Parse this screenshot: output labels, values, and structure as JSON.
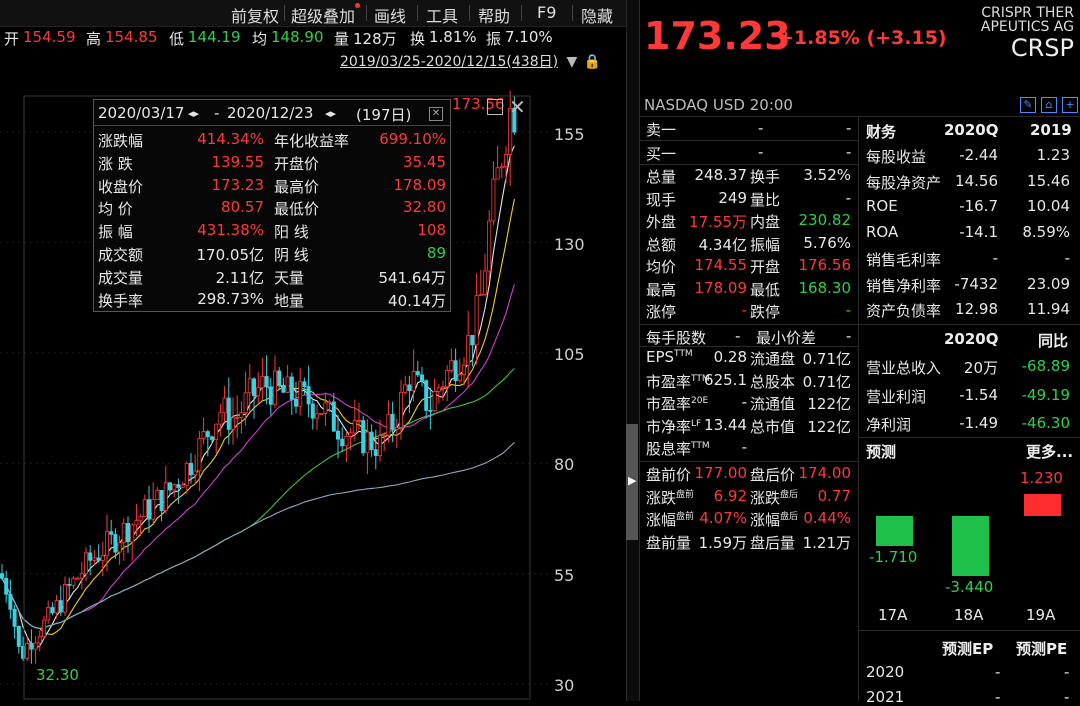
{
  "toolbar": {
    "items": [
      "前复权",
      "超级叠加",
      "画线",
      "工具",
      "帮助",
      "F9",
      "隐藏"
    ]
  },
  "quote": {
    "open_label": "开",
    "open": "154.59",
    "high_label": "高",
    "high": "154.85",
    "low_label": "低",
    "low": "144.19",
    "avg_label": "均",
    "avg": "148.90",
    "vol_label": "量",
    "vol": "128万",
    "turn_label": "换",
    "turn": "1.81%",
    "amp_label": "振",
    "amp": "7.10%"
  },
  "range": {
    "text": "2019/03/25-2020/12/15(438日)"
  },
  "chart": {
    "y_ticks": [
      "155",
      "130",
      "105",
      "80",
      "55",
      "30"
    ],
    "high_marker": "173.56",
    "low_marker": "32.30"
  },
  "stats": {
    "date_start": "2020/03/17",
    "date_end": "2020/12/23",
    "days": "(197日)",
    "rows": [
      {
        "l1": "涨跌幅",
        "v1": "414.34%",
        "l2": "年化收益率",
        "v2": "699.10%"
      },
      {
        "l1": "涨  跌",
        "v1": "139.55",
        "l2": "开盘价",
        "v2": "35.45"
      },
      {
        "l1": "收盘价",
        "v1": "173.23",
        "l2": "最高价",
        "v2": "178.09"
      },
      {
        "l1": "均  价",
        "v1": "80.57",
        "l2": "最低价",
        "v2": "32.80"
      },
      {
        "l1": "振  幅",
        "v1": "431.38%",
        "l2": "阳  线",
        "v2": "108"
      },
      {
        "l1": "成交额",
        "v1": "170.05亿",
        "l2": "阴  线",
        "v2": "89"
      },
      {
        "l1": "成交量",
        "v1": "2.11亿",
        "l2": "天量",
        "v2": "541.64万"
      },
      {
        "l1": "换手率",
        "v1": "298.73%",
        "l2": "地量",
        "v2": "40.14万"
      }
    ]
  },
  "header": {
    "price": "173.23",
    "change": "+1.85% (+3.15)",
    "company_line1": "CRISPR THER",
    "company_line2": "APEUTICS AG",
    "ticker": "CRSP",
    "exchange": "NASDAQ",
    "currency": "USD",
    "time": "20:00"
  },
  "orderbook": {
    "sell1_label": "卖一",
    "sell1_a": "-",
    "sell1_b": "-",
    "buy1_label": "买一",
    "buy1_a": "-",
    "buy1_b": "-"
  },
  "details": [
    {
      "l1": "总量",
      "v1": "248.37",
      "l2": "换手",
      "v2": "3.52%"
    },
    {
      "l1": "现手",
      "v1": "249",
      "l2": "量比",
      "v2": "-"
    },
    {
      "l1": "外盘",
      "v1": "17.55万",
      "l2": "内盘",
      "v2": "230.82"
    },
    {
      "l1": "总额",
      "v1": "4.34亿",
      "l2": "振幅",
      "v2": "5.76%"
    },
    {
      "l1": "均价",
      "v1": "174.55",
      "l2": "开盘",
      "v2": "176.56"
    },
    {
      "l1": "最高",
      "v1": "178.09",
      "l2": "最低",
      "v2": "168.30"
    },
    {
      "l1": "涨停",
      "v1": "-",
      "l2": "跌停",
      "v2": "-"
    }
  ],
  "shares": {
    "row0_l1": "每手股数",
    "row0_v1": "-",
    "row0_l2": "最小价差",
    "row0_v2": "-",
    "rows": [
      {
        "l1": "EPS",
        "s1": "TTM",
        "v1": "0.28",
        "l2": "流通盘",
        "v2": "0.71亿"
      },
      {
        "l1": "市盈率",
        "s1": "TTM",
        "v1": "625.1",
        "l2": "总股本",
        "v2": "0.71亿"
      },
      {
        "l1": "市盈率",
        "s1": "20E",
        "v1": "-",
        "l2": "流通值",
        "v2": "122亿"
      },
      {
        "l1": "市净率",
        "s1": "LF",
        "v1": "13.44",
        "l2": "总市值",
        "v2": "122亿"
      },
      {
        "l1": "股息率",
        "s1": "TTM",
        "v1": "-",
        "l2": "",
        "v2": ""
      }
    ]
  },
  "prepost": [
    {
      "l1": "盘前价",
      "s1": "",
      "v1": "177.00",
      "l2": "盘后价",
      "s2": "",
      "v2": "174.00"
    },
    {
      "l1": "涨跌",
      "s1": "盘前",
      "v1": "6.92",
      "l2": "涨跌",
      "s2": "盘后",
      "v2": "0.77"
    },
    {
      "l1": "涨幅",
      "s1": "盘前",
      "v1": "4.07%",
      "l2": "涨幅",
      "s2": "盘后",
      "v2": "0.44%"
    },
    {
      "l1": "盘前量",
      "s1": "",
      "v1": "1.59万",
      "l2": "盘后量",
      "s2": "",
      "v2": "1.21万"
    }
  ],
  "finance": {
    "header": {
      "c0": "财务",
      "c1": "2020Q",
      "c2": "2019"
    },
    "rows": [
      {
        "k": "每股收益",
        "a": "-2.44",
        "b": "1.23"
      },
      {
        "k": "每股净资产",
        "a": "14.56",
        "b": "15.46"
      },
      {
        "k": "ROE",
        "a": "-16.7",
        "b": "10.04"
      },
      {
        "k": "ROA",
        "a": "-14.1",
        "b": "8.59%"
      },
      {
        "k": "销售毛利率",
        "a": "-",
        "b": "-"
      },
      {
        "k": "销售净利率",
        "a": "-7432",
        "b": "23.09"
      },
      {
        "k": "资产负债率",
        "a": "12.98",
        "b": "11.94"
      }
    ],
    "header2": {
      "c1": "2020Q",
      "c2": "同比"
    },
    "rows2": [
      {
        "k": "营业总收入",
        "a": "20万",
        "b": "-68.89"
      },
      {
        "k": "营业利润",
        "a": "-1.54",
        "b": "-49.19"
      },
      {
        "k": "净利润",
        "a": "-1.49",
        "b": "-46.30"
      }
    ]
  },
  "forecast": {
    "title": "预测",
    "more": "更多...",
    "years": [
      "17A",
      "18A",
      "19A"
    ],
    "values": [
      "-1.710",
      "-3.440",
      "1.230"
    ],
    "nums": [
      -1.71,
      -3.44,
      1.23
    ],
    "ep_header": "预测EP",
    "pe_header": "预测PE",
    "rows": [
      {
        "year": "2020",
        "ep": "-",
        "pe": "-"
      },
      {
        "year": "2021",
        "ep": "-",
        "pe": "-"
      }
    ]
  },
  "colors": {
    "up": "#ff3838",
    "down": "#2fd04b",
    "accent": "#4a8cff"
  }
}
